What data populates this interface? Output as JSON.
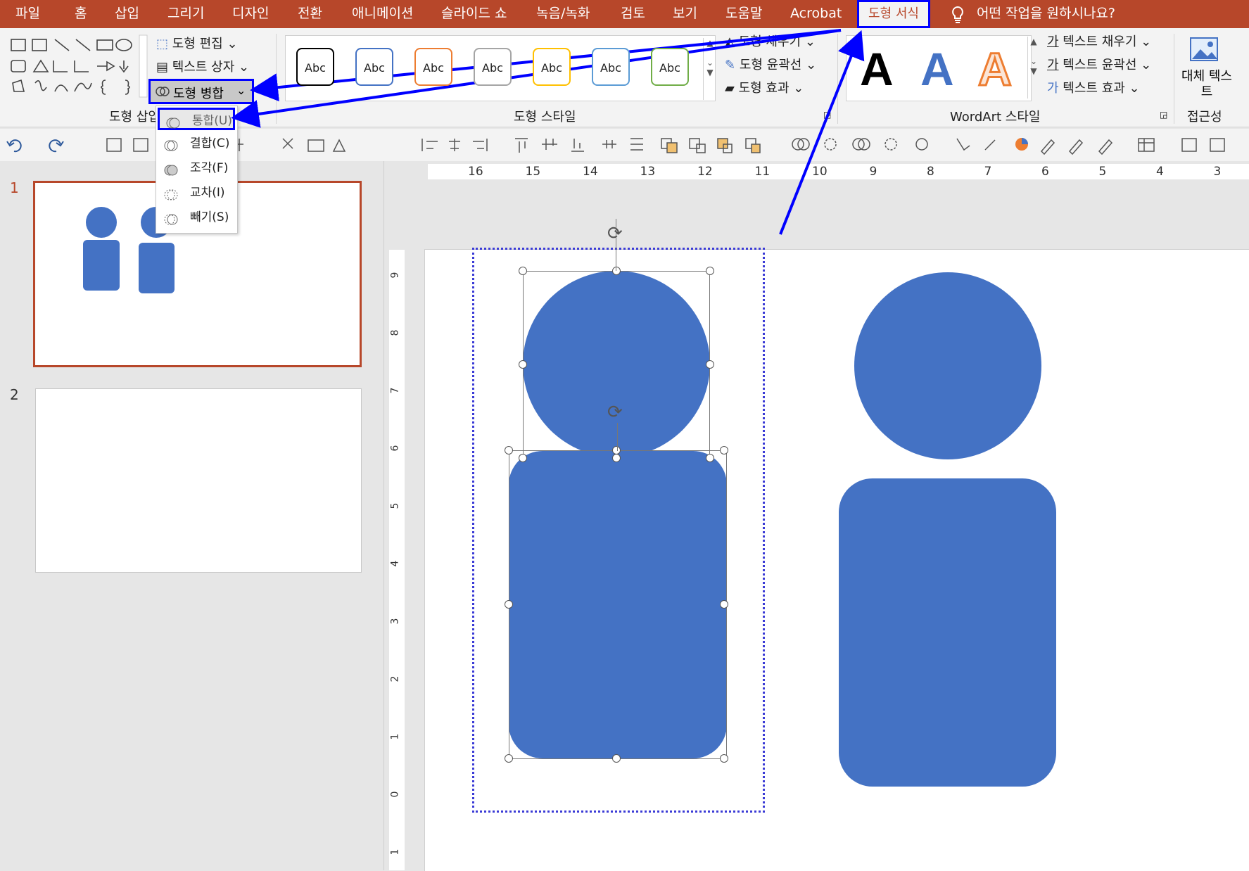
{
  "menu": {
    "items": [
      "파일",
      "홈",
      "삽입",
      "그리기",
      "디자인",
      "전환",
      "애니메이션",
      "슬라이드 쇼",
      "녹음/녹화",
      "검토",
      "보기",
      "도움말",
      "Acrobat"
    ],
    "active_tab": "도형 서식",
    "tell_me": "어떤 작업을 원하시나요?"
  },
  "ribbon": {
    "insert_shapes": {
      "edit_shape": "도형 편집",
      "text_box": "텍스트 상자",
      "merge_shapes": "도형 병합",
      "label": "도형 삽입"
    },
    "shape_styles": {
      "presets": [
        "Abc",
        "Abc",
        "Abc",
        "Abc",
        "Abc",
        "Abc",
        "Abc"
      ],
      "preset_colors": [
        "#000000",
        "#4472c4",
        "#ed7d31",
        "#a5a5a5",
        "#ffc000",
        "#5b9bd5",
        "#70ad47"
      ],
      "fill": "도형 채우기",
      "outline": "도형 윤곽선",
      "effects": "도형 효과",
      "label": "도형 스타일"
    },
    "wordart": {
      "letters": [
        "A",
        "A",
        "A"
      ],
      "text_fill": "텍스트 채우기",
      "text_outline": "텍스트 윤곽선",
      "text_effects": "텍스트 효과",
      "label": "WordArt 스타일"
    },
    "accessibility": {
      "alt_text": "대체 텍스트",
      "label": "접근성"
    }
  },
  "merge_dropdown": {
    "items": [
      {
        "label": "통합(U)",
        "icon": "union-icon"
      },
      {
        "label": "결합(C)",
        "icon": "combine-icon"
      },
      {
        "label": "조각(F)",
        "icon": "fragment-icon"
      },
      {
        "label": "교차(I)",
        "icon": "intersect-icon"
      },
      {
        "label": "빼기(S)",
        "icon": "subtract-icon"
      }
    ]
  },
  "slides": {
    "numbers": [
      "1",
      "2"
    ]
  },
  "ruler": {
    "horizontal": [
      "16",
      "15",
      "14",
      "13",
      "12",
      "11",
      "10",
      "9",
      "8",
      "7",
      "6",
      "5",
      "4",
      "3"
    ],
    "vertical": [
      "9",
      "8",
      "7",
      "6",
      "5",
      "4",
      "3",
      "2",
      "1",
      "0",
      "1"
    ]
  },
  "colors": {
    "brand": "#b7472a",
    "shape": "#4472c4",
    "annotation": "#0000ff"
  }
}
